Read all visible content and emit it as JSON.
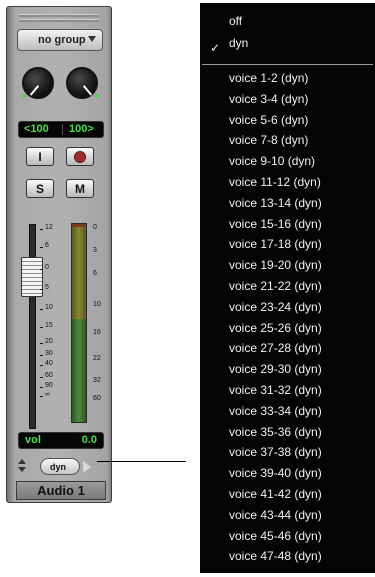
{
  "strip": {
    "group_label": "no group",
    "pan_left": "<100",
    "pan_right": "100>",
    "input_label": "I",
    "solo_label": "S",
    "mute_label": "M",
    "fader_scale": [
      "12",
      "6",
      "0",
      "5",
      "10",
      "15",
      "20",
      "30",
      "40",
      "60",
      "90",
      "∞"
    ],
    "meter_scale": [
      "0",
      "3",
      "6",
      "10",
      "16",
      "22",
      "32",
      "60"
    ],
    "vol_label": "vol",
    "vol_value": "0.0",
    "voice_label": "dyn",
    "track_name": "Audio 1"
  },
  "menu": {
    "checked_item": "dyn",
    "top_items": [
      "off",
      "dyn"
    ],
    "voice_items": [
      "voice 1-2 (dyn)",
      "voice 3-4 (dyn)",
      "voice 5-6 (dyn)",
      "voice 7-8 (dyn)",
      "voice 9-10 (dyn)",
      "voice 11-12 (dyn)",
      "voice 13-14 (dyn)",
      "voice 15-16 (dyn)",
      "voice 17-18 (dyn)",
      "voice 19-20 (dyn)",
      "voice 21-22 (dyn)",
      "voice 23-24 (dyn)",
      "voice 25-26 (dyn)",
      "voice 27-28 (dyn)",
      "voice 29-30 (dyn)",
      "voice 31-32 (dyn)",
      "voice 33-34 (dyn)",
      "voice 35-36 (dyn)",
      "voice 37-38 (dyn)",
      "voice 39-40 (dyn)",
      "voice 41-42 (dyn)",
      "voice 43-44 (dyn)",
      "voice 45-46 (dyn)",
      "voice 47-48 (dyn)"
    ]
  },
  "colors": {
    "readout_green": "#49e04a",
    "menu_bg": "#040404",
    "record_red": "#9b2d2d"
  }
}
